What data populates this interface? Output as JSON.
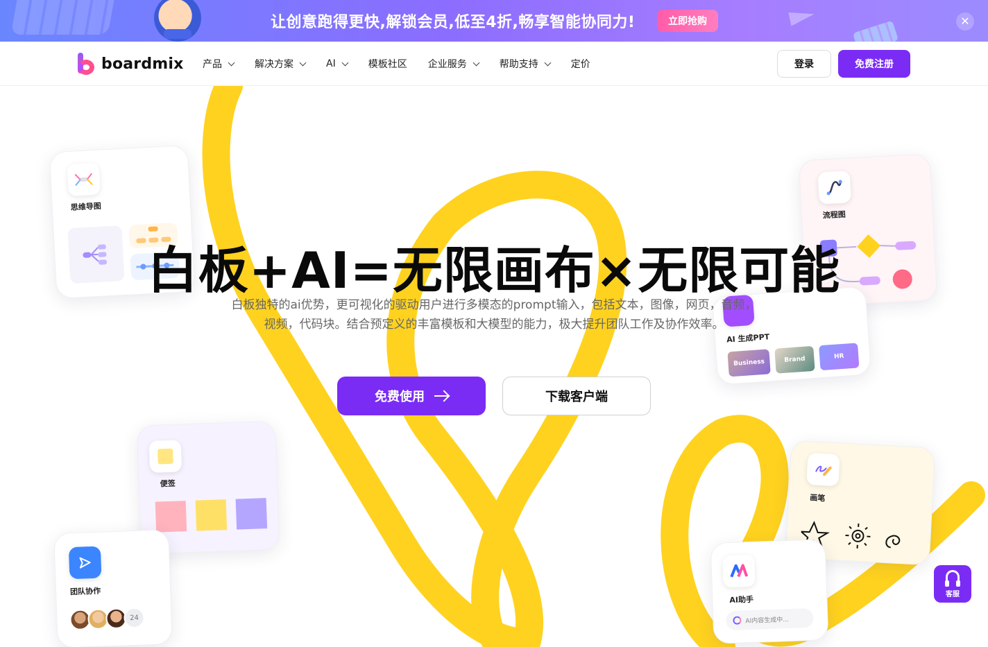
{
  "promo": {
    "text": "让创意跑得更快,解锁会员,低至4折,畅享智能协同力!",
    "cta": "立即抢购",
    "close_icon": "close-icon"
  },
  "nav": {
    "logo_text": "boardmix",
    "items": [
      {
        "label": "产品",
        "dropdown": true
      },
      {
        "label": "解决方案",
        "dropdown": true
      },
      {
        "label": "AI",
        "dropdown": true
      },
      {
        "label": "模板社区",
        "dropdown": false
      },
      {
        "label": "企业服务",
        "dropdown": true
      },
      {
        "label": "帮助支持",
        "dropdown": true
      },
      {
        "label": "定价",
        "dropdown": false
      }
    ],
    "login": "登录",
    "signup": "免费注册"
  },
  "hero": {
    "headline": "白板+AI=无限画布×无限可能",
    "subline_1": "白板独特的ai优势，更可视化的驱动用户进行多模态的prompt输入，包括文本，图像，网页，音频，",
    "subline_2": "视频，代码块。结合预定义的丰富模板和大模型的能力，极大提升团队工作及协作效率。",
    "primary_cta": "免费使用",
    "secondary_cta": "下载客户端"
  },
  "cards": {
    "mindmap": "思维导图",
    "flowchart": "流程图",
    "ai_ppt": "AI 生成PPT",
    "ppt_themes": [
      "Business",
      "Brand",
      "HR"
    ],
    "sticky": "便签",
    "pen": "画笔",
    "team": "团队协作",
    "team_count": "24",
    "ai_assistant": "AI助手",
    "ai_generating": "AI内容生成中..."
  },
  "support": {
    "label": "客服"
  },
  "colors": {
    "brand": "#7a2cf5",
    "swirl": "#ffd21f",
    "sticky": [
      "#ffb3bd",
      "#ffe066",
      "#b4a6ff"
    ]
  }
}
